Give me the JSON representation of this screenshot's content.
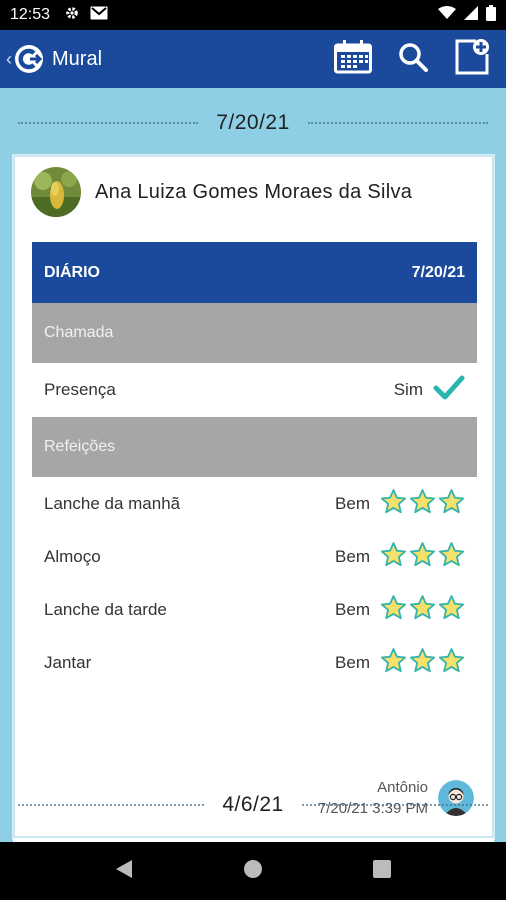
{
  "status_bar": {
    "time": "12:53"
  },
  "app_bar": {
    "title": "Mural",
    "colors": {
      "primary": "#1b4a9c",
      "background": "#8fcfe6"
    },
    "actions": [
      "calendar-icon",
      "search-icon",
      "new-post-icon"
    ]
  },
  "feed": {
    "date_separator_1": "7/20/21",
    "date_separator_2": "4/6/21",
    "post": {
      "student_name": "Ana Luiza Gomes Moraes da Silva",
      "diary": {
        "title": "DIÁRIO",
        "date": "7/20/21",
        "sections": [
          {
            "title": "Chamada",
            "rows": [
              {
                "label": "Presença",
                "value": "Sim",
                "indicator": "check"
              }
            ]
          },
          {
            "title": "Refeições",
            "rows": [
              {
                "label": "Lanche da manhã",
                "value": "Bem",
                "stars": 3
              },
              {
                "label": "Almoço",
                "value": "Bem",
                "stars": 3
              },
              {
                "label": "Lanche da tarde",
                "value": "Bem",
                "stars": 3
              },
              {
                "label": "Jantar",
                "value": "Bem",
                "stars": 3
              }
            ]
          }
        ]
      },
      "author": "Antônio",
      "timestamp": "7/20/21 3:39 PM"
    }
  }
}
